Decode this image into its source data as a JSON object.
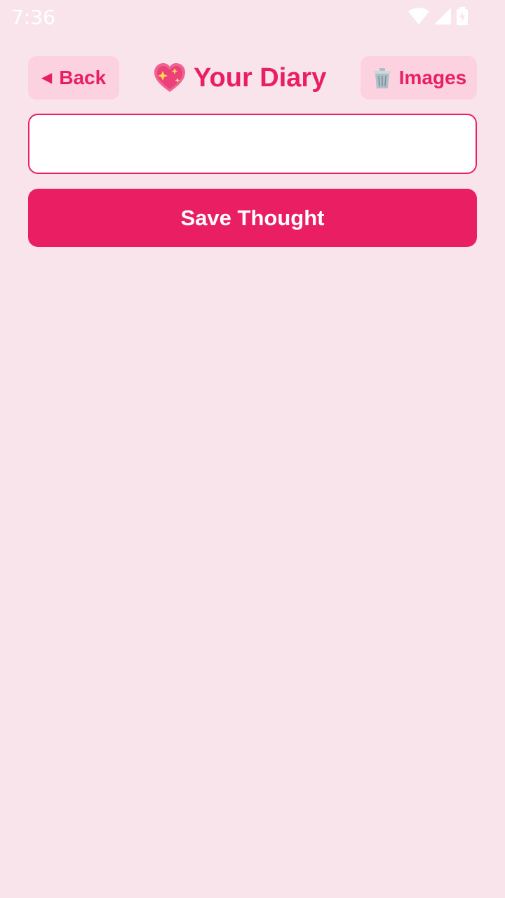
{
  "status_bar": {
    "time": "7:36",
    "icons": [
      "wifi-icon",
      "cellular-signal-icon",
      "battery-charging-icon"
    ]
  },
  "header": {
    "back_label": "Back",
    "back_icon": "left-triangle-icon",
    "title": "Your Diary",
    "title_icon": "sparkling-heart-icon",
    "images_label": "Images",
    "images_icon": "wastebasket-icon"
  },
  "entry": {
    "value": "",
    "placeholder": ""
  },
  "save_label": "Save Thought",
  "colors": {
    "background": "#f9e4eb",
    "accent": "#e91e63",
    "button_soft": "#fcd1e0",
    "input_bg": "#ffffff"
  }
}
